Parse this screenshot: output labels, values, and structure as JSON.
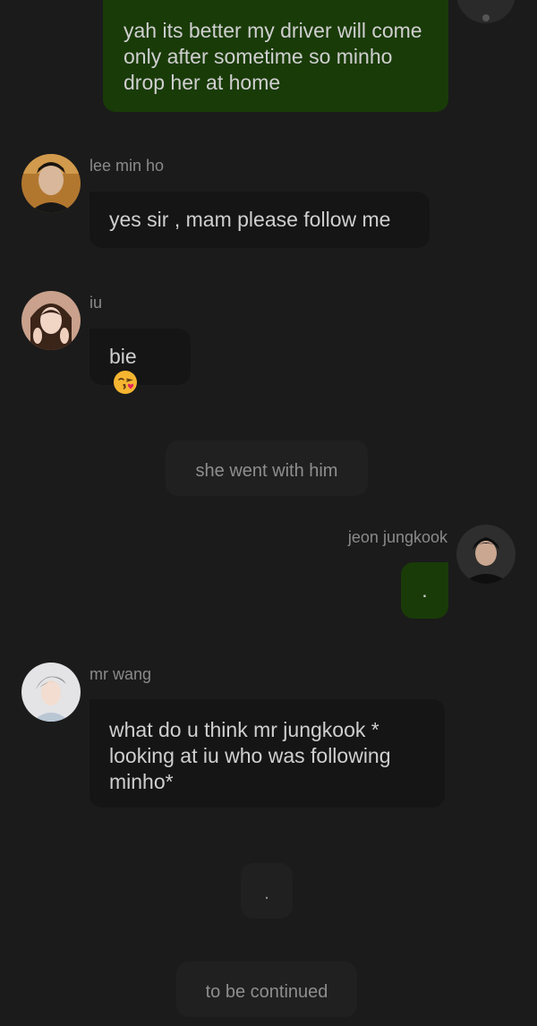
{
  "messages": [
    {
      "sender": "",
      "text": "yah its better my driver will come only after sometime so minho drop her at home"
    },
    {
      "sender": "lee min ho",
      "text": "yes sir , mam please follow me"
    },
    {
      "sender": "iu",
      "text": "bie",
      "emoji": "kissing-face-icon"
    },
    {
      "narration": "she went with him"
    },
    {
      "sender": "jeon jungkook",
      "text": "."
    },
    {
      "sender": "mr wang",
      "text": "what do u think mr jungkook * looking at iu who was following minho*"
    },
    {
      "narration": "."
    },
    {
      "narration": "to be continued"
    }
  ],
  "colors": {
    "background": "#1b1b1b",
    "incoming_bubble": "#151515",
    "outgoing_bubble": "#193b08",
    "narration_bubble": "#202020"
  }
}
